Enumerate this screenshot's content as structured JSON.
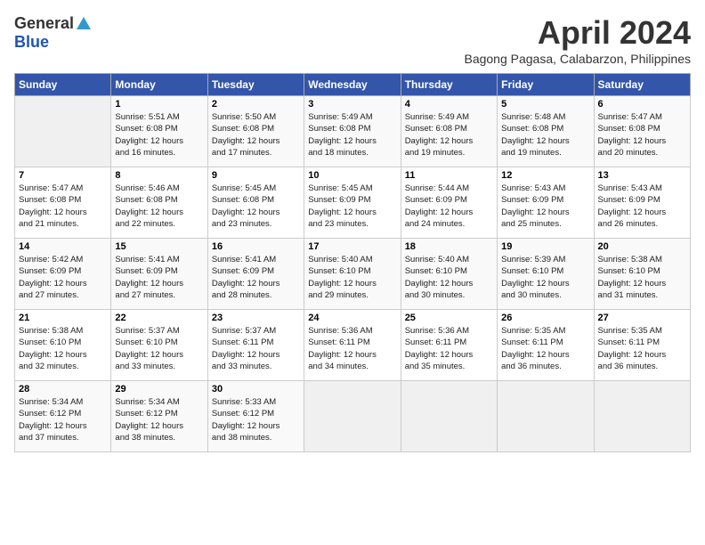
{
  "logo": {
    "general": "General",
    "blue": "Blue"
  },
  "title": "April 2024",
  "subtitle": "Bagong Pagasa, Calabarzon, Philippines",
  "days_of_week": [
    "Sunday",
    "Monday",
    "Tuesday",
    "Wednesday",
    "Thursday",
    "Friday",
    "Saturday"
  ],
  "weeks": [
    [
      {
        "day": "",
        "info": ""
      },
      {
        "day": "1",
        "info": "Sunrise: 5:51 AM\nSunset: 6:08 PM\nDaylight: 12 hours\nand 16 minutes."
      },
      {
        "day": "2",
        "info": "Sunrise: 5:50 AM\nSunset: 6:08 PM\nDaylight: 12 hours\nand 17 minutes."
      },
      {
        "day": "3",
        "info": "Sunrise: 5:49 AM\nSunset: 6:08 PM\nDaylight: 12 hours\nand 18 minutes."
      },
      {
        "day": "4",
        "info": "Sunrise: 5:49 AM\nSunset: 6:08 PM\nDaylight: 12 hours\nand 19 minutes."
      },
      {
        "day": "5",
        "info": "Sunrise: 5:48 AM\nSunset: 6:08 PM\nDaylight: 12 hours\nand 19 minutes."
      },
      {
        "day": "6",
        "info": "Sunrise: 5:47 AM\nSunset: 6:08 PM\nDaylight: 12 hours\nand 20 minutes."
      }
    ],
    [
      {
        "day": "7",
        "info": "Sunrise: 5:47 AM\nSunset: 6:08 PM\nDaylight: 12 hours\nand 21 minutes."
      },
      {
        "day": "8",
        "info": "Sunrise: 5:46 AM\nSunset: 6:08 PM\nDaylight: 12 hours\nand 22 minutes."
      },
      {
        "day": "9",
        "info": "Sunrise: 5:45 AM\nSunset: 6:08 PM\nDaylight: 12 hours\nand 23 minutes."
      },
      {
        "day": "10",
        "info": "Sunrise: 5:45 AM\nSunset: 6:09 PM\nDaylight: 12 hours\nand 23 minutes."
      },
      {
        "day": "11",
        "info": "Sunrise: 5:44 AM\nSunset: 6:09 PM\nDaylight: 12 hours\nand 24 minutes."
      },
      {
        "day": "12",
        "info": "Sunrise: 5:43 AM\nSunset: 6:09 PM\nDaylight: 12 hours\nand 25 minutes."
      },
      {
        "day": "13",
        "info": "Sunrise: 5:43 AM\nSunset: 6:09 PM\nDaylight: 12 hours\nand 26 minutes."
      }
    ],
    [
      {
        "day": "14",
        "info": "Sunrise: 5:42 AM\nSunset: 6:09 PM\nDaylight: 12 hours\nand 27 minutes."
      },
      {
        "day": "15",
        "info": "Sunrise: 5:41 AM\nSunset: 6:09 PM\nDaylight: 12 hours\nand 27 minutes."
      },
      {
        "day": "16",
        "info": "Sunrise: 5:41 AM\nSunset: 6:09 PM\nDaylight: 12 hours\nand 28 minutes."
      },
      {
        "day": "17",
        "info": "Sunrise: 5:40 AM\nSunset: 6:10 PM\nDaylight: 12 hours\nand 29 minutes."
      },
      {
        "day": "18",
        "info": "Sunrise: 5:40 AM\nSunset: 6:10 PM\nDaylight: 12 hours\nand 30 minutes."
      },
      {
        "day": "19",
        "info": "Sunrise: 5:39 AM\nSunset: 6:10 PM\nDaylight: 12 hours\nand 30 minutes."
      },
      {
        "day": "20",
        "info": "Sunrise: 5:38 AM\nSunset: 6:10 PM\nDaylight: 12 hours\nand 31 minutes."
      }
    ],
    [
      {
        "day": "21",
        "info": "Sunrise: 5:38 AM\nSunset: 6:10 PM\nDaylight: 12 hours\nand 32 minutes."
      },
      {
        "day": "22",
        "info": "Sunrise: 5:37 AM\nSunset: 6:10 PM\nDaylight: 12 hours\nand 33 minutes."
      },
      {
        "day": "23",
        "info": "Sunrise: 5:37 AM\nSunset: 6:11 PM\nDaylight: 12 hours\nand 33 minutes."
      },
      {
        "day": "24",
        "info": "Sunrise: 5:36 AM\nSunset: 6:11 PM\nDaylight: 12 hours\nand 34 minutes."
      },
      {
        "day": "25",
        "info": "Sunrise: 5:36 AM\nSunset: 6:11 PM\nDaylight: 12 hours\nand 35 minutes."
      },
      {
        "day": "26",
        "info": "Sunrise: 5:35 AM\nSunset: 6:11 PM\nDaylight: 12 hours\nand 36 minutes."
      },
      {
        "day": "27",
        "info": "Sunrise: 5:35 AM\nSunset: 6:11 PM\nDaylight: 12 hours\nand 36 minutes."
      }
    ],
    [
      {
        "day": "28",
        "info": "Sunrise: 5:34 AM\nSunset: 6:12 PM\nDaylight: 12 hours\nand 37 minutes."
      },
      {
        "day": "29",
        "info": "Sunrise: 5:34 AM\nSunset: 6:12 PM\nDaylight: 12 hours\nand 38 minutes."
      },
      {
        "day": "30",
        "info": "Sunrise: 5:33 AM\nSunset: 6:12 PM\nDaylight: 12 hours\nand 38 minutes."
      },
      {
        "day": "",
        "info": ""
      },
      {
        "day": "",
        "info": ""
      },
      {
        "day": "",
        "info": ""
      },
      {
        "day": "",
        "info": ""
      }
    ]
  ]
}
